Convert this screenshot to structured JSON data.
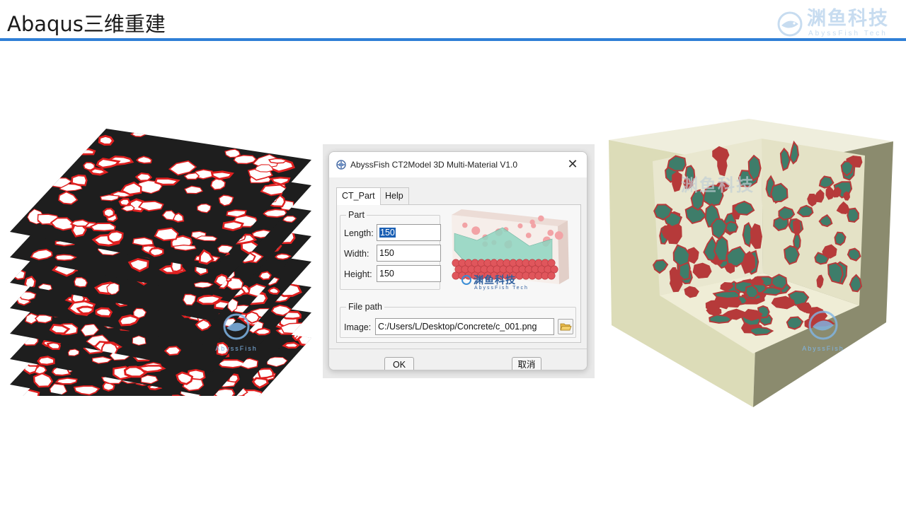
{
  "slide": {
    "title": "Abaqus三维重建"
  },
  "brand": {
    "name": "渊鱼科技",
    "tagline": "AbyssFish Tech"
  },
  "colors": {
    "accent": "#2f7fd6",
    "slice_matrix": "#1e1e1e",
    "slice_interface": "#e02020",
    "cube_matrix": "#e9e7cf",
    "cube_aggregate": "#3e7d6a",
    "cube_interface": "#b63a3a"
  },
  "dialog": {
    "title": "AbyssFish CT2Model 3D Multi-Material V1.0",
    "close_glyph": "✕",
    "tabs": [
      {
        "label": "CT_Part",
        "active": true
      },
      {
        "label": "Help",
        "active": false
      }
    ],
    "part_group": {
      "label": "Part",
      "length_label": "Length:",
      "length_value": "150",
      "width_label": "Width:",
      "width_value": "150",
      "height_label": "Height:",
      "height_value": "150"
    },
    "filepath_group": {
      "label": "File path",
      "image_label": "Image:",
      "image_value": "C:/Users/L/Desktop/Concrete/c_001.png",
      "browse_icon": "folder-open-icon"
    },
    "preview_brand": "渊鱼科技",
    "preview_tagline": "AbyssFish Tech",
    "ok_label": "OK",
    "cancel_label": "取消"
  },
  "watermarks": {
    "slices_text": "AbyssFish",
    "cube_text": "AbyssFish",
    "cube_top_brand": "渊鱼科技"
  }
}
